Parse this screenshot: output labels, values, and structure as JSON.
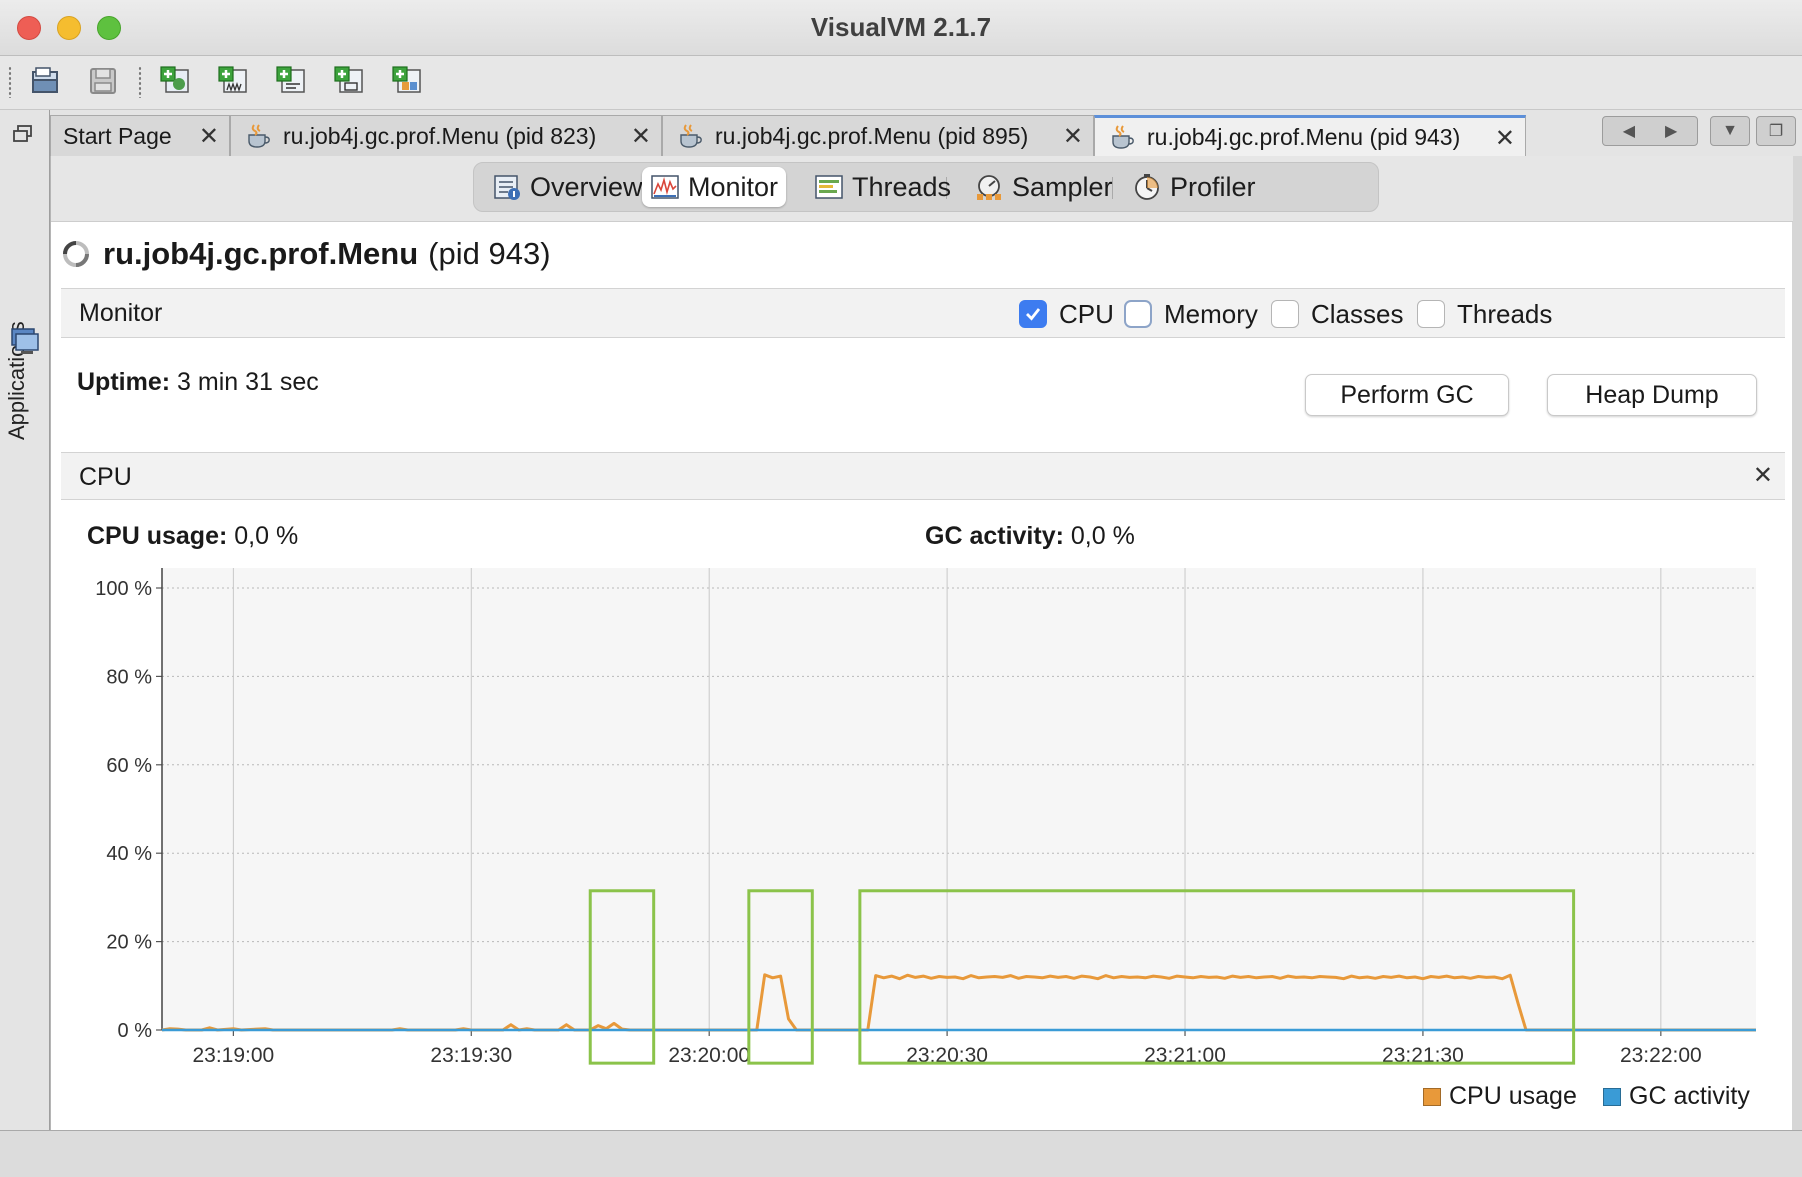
{
  "window": {
    "title": "VisualVM 2.1.7"
  },
  "toolbar": {
    "buttons": [
      "open-snapshot",
      "save",
      "add-application",
      "add-jmx-connection",
      "load-thread-dump",
      "load-heap-dump",
      "load-profiler-snapshot"
    ]
  },
  "side_panel": {
    "label": "Applications"
  },
  "doc_tabs": [
    {
      "label": "Start Page",
      "close": "✕"
    },
    {
      "label": "ru.job4j.gc.prof.Menu (pid 823)",
      "close": "✕"
    },
    {
      "label": "ru.job4j.gc.prof.Menu (pid 895)",
      "close": "✕"
    },
    {
      "label": "ru.job4j.gc.prof.Menu (pid 943)",
      "close": "✕",
      "active": true
    }
  ],
  "sub_tabs": [
    {
      "label": "Overview"
    },
    {
      "label": "Monitor",
      "active": true
    },
    {
      "label": "Threads"
    },
    {
      "label": "Sampler"
    },
    {
      "label": "Profiler"
    }
  ],
  "process": {
    "name": "ru.job4j.gc.prof.Menu",
    "pid": "(pid 943)"
  },
  "monitor": {
    "title": "Monitor",
    "checkboxes": [
      {
        "label": "CPU",
        "checked": true
      },
      {
        "label": "Memory",
        "checked": false
      },
      {
        "label": "Classes",
        "checked": false
      },
      {
        "label": "Threads",
        "checked": false
      }
    ]
  },
  "uptime": {
    "label": "Uptime:",
    "value": "3 min 31 sec"
  },
  "buttons": {
    "perform_gc": "Perform GC",
    "heap_dump": "Heap Dump"
  },
  "cpu_panel": {
    "title": "CPU",
    "close": "✕",
    "cpu_usage_label": "CPU usage:",
    "cpu_usage_value": "0,0 %",
    "gc_activity_label": "GC activity:",
    "gc_activity_value": "0,0 %"
  },
  "legend": [
    {
      "label": "CPU usage",
      "color": "#e8993a"
    },
    {
      "label": "GC activity",
      "color": "#3a9bd6"
    }
  ],
  "colors": {
    "cpu_line": "#e8993a",
    "gc_line": "#3a9bd6",
    "highlight_box": "#8bc34a",
    "checkbox_accent": "#3d7cf0"
  },
  "chart_data": {
    "type": "line",
    "title": "",
    "xlabel": "",
    "ylabel": "",
    "ylim": [
      0,
      100
    ],
    "xlim": [
      "23:18:51",
      "23:22:12"
    ],
    "y_ticks": [
      "0 %",
      "20 %",
      "40 %",
      "60 %",
      "80 %",
      "100 %"
    ],
    "x_ticks": [
      "23:19:00",
      "23:19:30",
      "23:20:00",
      "23:20:30",
      "23:21:00",
      "23:21:30",
      "23:22:00"
    ],
    "grid": true,
    "legend_position": "bottom-right",
    "series": [
      {
        "name": "CPU usage",
        "points": [
          [
            "23:18:51",
            0.0
          ],
          [
            "23:18:52",
            0.3
          ],
          [
            "23:18:53",
            0.2
          ],
          [
            "23:18:54",
            0.0
          ],
          [
            "23:18:56",
            0.0
          ],
          [
            "23:18:57",
            0.5
          ],
          [
            "23:18:58",
            0.0
          ],
          [
            "23:19:00",
            0.3
          ],
          [
            "23:19:01",
            0.0
          ],
          [
            "23:19:04",
            0.3
          ],
          [
            "23:19:05",
            0.0
          ],
          [
            "23:19:20",
            0.0
          ],
          [
            "23:19:21",
            0.3
          ],
          [
            "23:19:22",
            0.0
          ],
          [
            "23:19:28",
            0.0
          ],
          [
            "23:19:29",
            0.3
          ],
          [
            "23:19:30",
            0.0
          ],
          [
            "23:19:34",
            0.0
          ],
          [
            "23:19:35",
            1.2
          ],
          [
            "23:19:36",
            0.0
          ],
          [
            "23:19:37",
            0.3
          ],
          [
            "23:19:38",
            0.0
          ],
          [
            "23:19:41",
            0.0
          ],
          [
            "23:19:42",
            1.2
          ],
          [
            "23:19:43",
            0.0
          ],
          [
            "23:19:45",
            0.0
          ],
          [
            "23:19:46",
            1.0
          ],
          [
            "23:19:47",
            0.3
          ],
          [
            "23:19:48",
            1.5
          ],
          [
            "23:19:49",
            0.2
          ],
          [
            "23:19:50",
            0.0
          ],
          [
            "23:20:06",
            0.0
          ],
          [
            "23:20:07",
            12.5
          ],
          [
            "23:20:08",
            11.8
          ],
          [
            "23:20:09",
            12.2
          ],
          [
            "23:20:10",
            2.5
          ],
          [
            "23:20:11",
            0.0
          ],
          [
            "23:20:20",
            0.0
          ],
          [
            "23:20:21",
            12.3
          ],
          [
            "23:20:22",
            11.8
          ],
          [
            "23:20:23",
            12.2
          ],
          [
            "23:20:24",
            11.6
          ],
          [
            "23:20:25",
            12.4
          ],
          [
            "23:20:26",
            11.9
          ],
          [
            "23:20:27",
            12.2
          ],
          [
            "23:20:28",
            11.7
          ],
          [
            "23:20:29",
            12.1
          ],
          [
            "23:20:30",
            11.9
          ],
          [
            "23:20:31",
            12.0
          ],
          [
            "23:20:32",
            11.6
          ],
          [
            "23:20:33",
            12.3
          ],
          [
            "23:20:34",
            11.8
          ],
          [
            "23:20:35",
            12.0
          ],
          [
            "23:20:36",
            12.1
          ],
          [
            "23:20:37",
            11.9
          ],
          [
            "23:20:38",
            12.3
          ],
          [
            "23:20:39",
            11.7
          ],
          [
            "23:20:40",
            12.1
          ],
          [
            "23:20:41",
            12.0
          ],
          [
            "23:20:42",
            11.8
          ],
          [
            "23:20:43",
            12.2
          ],
          [
            "23:20:44",
            11.9
          ],
          [
            "23:20:45",
            12.1
          ],
          [
            "23:20:46",
            11.7
          ],
          [
            "23:20:47",
            12.2
          ],
          [
            "23:20:48",
            12.0
          ],
          [
            "23:20:49",
            11.6
          ],
          [
            "23:20:50",
            12.3
          ],
          [
            "23:20:51",
            11.8
          ],
          [
            "23:20:52",
            12.1
          ],
          [
            "23:20:53",
            11.9
          ],
          [
            "23:20:54",
            12.0
          ],
          [
            "23:20:55",
            11.8
          ],
          [
            "23:20:56",
            12.2
          ],
          [
            "23:20:57",
            12.0
          ],
          [
            "23:20:58",
            11.7
          ],
          [
            "23:20:59",
            12.2
          ],
          [
            "23:21:00",
            12.0
          ],
          [
            "23:21:01",
            11.8
          ],
          [
            "23:21:02",
            12.1
          ],
          [
            "23:21:03",
            11.9
          ],
          [
            "23:21:04",
            12.0
          ],
          [
            "23:21:05",
            11.7
          ],
          [
            "23:21:06",
            12.2
          ],
          [
            "23:21:07",
            11.9
          ],
          [
            "23:21:08",
            12.1
          ],
          [
            "23:21:09",
            11.8
          ],
          [
            "23:21:10",
            12.0
          ],
          [
            "23:21:11",
            12.1
          ],
          [
            "23:21:12",
            11.7
          ],
          [
            "23:21:13",
            12.2
          ],
          [
            "23:21:14",
            11.9
          ],
          [
            "23:21:15",
            12.0
          ],
          [
            "23:21:16",
            11.8
          ],
          [
            "23:21:17",
            12.1
          ],
          [
            "23:21:18",
            12.0
          ],
          [
            "23:21:19",
            11.9
          ],
          [
            "23:21:20",
            11.6
          ],
          [
            "23:21:21",
            12.2
          ],
          [
            "23:21:22",
            11.8
          ],
          [
            "23:21:23",
            12.0
          ],
          [
            "23:21:24",
            11.7
          ],
          [
            "23:21:25",
            12.1
          ],
          [
            "23:21:26",
            11.9
          ],
          [
            "23:21:27",
            12.2
          ],
          [
            "23:21:28",
            11.8
          ],
          [
            "23:21:29",
            12.0
          ],
          [
            "23:21:30",
            11.6
          ],
          [
            "23:21:31",
            12.1
          ],
          [
            "23:21:32",
            11.9
          ],
          [
            "23:21:33",
            12.2
          ],
          [
            "23:21:34",
            11.8
          ],
          [
            "23:21:35",
            12.0
          ],
          [
            "23:21:36",
            11.7
          ],
          [
            "23:21:37",
            12.1
          ],
          [
            "23:21:38",
            11.9
          ],
          [
            "23:21:39",
            12.0
          ],
          [
            "23:21:40",
            11.6
          ],
          [
            "23:21:41",
            12.4
          ],
          [
            "23:21:42",
            6.0
          ],
          [
            "23:21:43",
            0.0
          ],
          [
            "23:22:12",
            0.0
          ]
        ]
      },
      {
        "name": "GC activity",
        "points": [
          [
            "23:18:51",
            0.0
          ],
          [
            "23:22:12",
            0.0
          ]
        ]
      }
    ],
    "annotations": [
      {
        "type": "box",
        "x_range": [
          "23:19:45",
          "23:19:53"
        ],
        "y_range": [
          -7.5,
          31.5
        ]
      },
      {
        "type": "box",
        "x_range": [
          "23:20:05",
          "23:20:13"
        ],
        "y_range": [
          -7.5,
          31.5
        ]
      },
      {
        "type": "box",
        "x_range": [
          "23:20:19",
          "23:21:49"
        ],
        "y_range": [
          -7.5,
          31.5
        ]
      }
    ]
  }
}
